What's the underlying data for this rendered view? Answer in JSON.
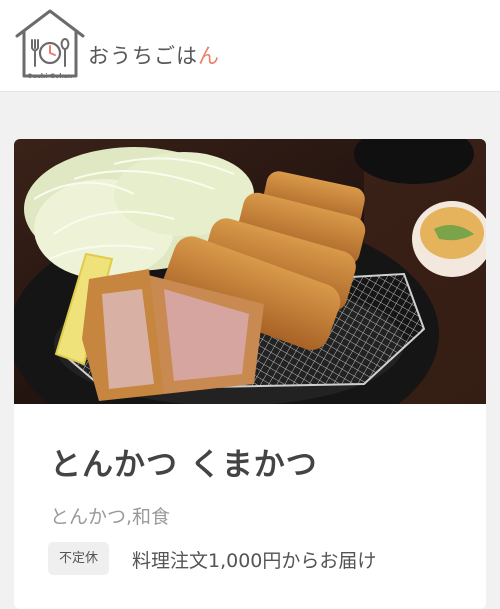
{
  "header": {
    "logo_mark_text": "Ouchi Gohan",
    "logo_text_main": "おうちごは",
    "logo_text_accent": "ん"
  },
  "shop": {
    "name": "とんかつ くまかつ",
    "category": "とんかつ,和食",
    "holiday_badge": "不定休",
    "delivery_info": "料理注文1,000円からお届け"
  },
  "colors": {
    "accent": "#e9806b",
    "logo_gray": "#6b6b6b",
    "title_text": "#444444",
    "muted_text": "#9a9a9a",
    "background": "#f1f1f1"
  }
}
